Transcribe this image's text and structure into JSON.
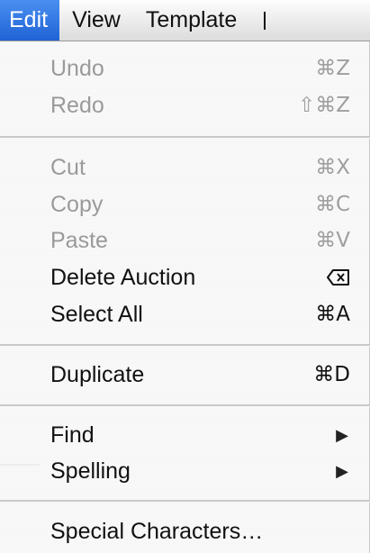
{
  "menubar": {
    "items": [
      "Edit",
      "View",
      "Template",
      ""
    ],
    "active_index": 0
  },
  "menu": {
    "items": [
      {
        "label": "Undo",
        "shortcut": "⌘Z",
        "enabled": false
      },
      {
        "label": "Redo",
        "shortcut": "⇧⌘Z",
        "enabled": false
      },
      {
        "label": "Cut",
        "shortcut": "⌘X",
        "enabled": false
      },
      {
        "label": "Copy",
        "shortcut": "⌘C",
        "enabled": false
      },
      {
        "label": "Paste",
        "shortcut": "⌘V",
        "enabled": false
      },
      {
        "label": "Delete Auction",
        "shortcut_icon": "delete-key-icon",
        "enabled": true
      },
      {
        "label": "Select All",
        "shortcut": "⌘A",
        "enabled": true
      },
      {
        "label": "Duplicate",
        "shortcut": "⌘D",
        "enabled": true
      },
      {
        "label": "Find",
        "submenu_icon": "submenu-arrow-icon",
        "enabled": true
      },
      {
        "label": "Spelling",
        "submenu_icon": "submenu-arrow-icon",
        "enabled": true
      },
      {
        "label": "Special Characters…",
        "enabled": true
      }
    ]
  },
  "colors": {
    "highlight": "#1f63d6",
    "disabled_text": "#9a9a9a",
    "enabled_text": "#111111"
  }
}
